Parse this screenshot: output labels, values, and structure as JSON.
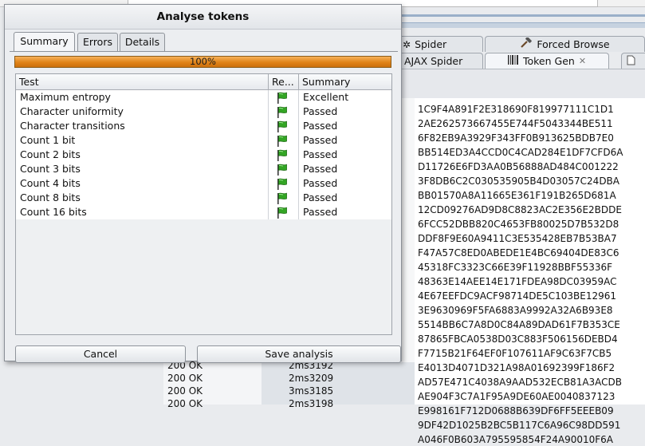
{
  "background": {
    "tabs": {
      "spider": "Spider",
      "forced_browse": "Forced Browse",
      "ajax_spider": "AJAX Spider",
      "token_gen": "Token Gen"
    },
    "tokens": [
      "1C9F4A891F2E318690F819977111C1D1",
      "2AE262573667455E744F5043344BE511",
      "6F82EB9A3929F343FF0B913625BDB7E0",
      "BB514ED3A4CCD0C4CAD284E1DF7CFD6A",
      "D11726E6FD3AA0B56888AD484C001222",
      "3F8DB6C2C030535905B4D03057C24DBA",
      "BB01570A8A11665E361F191B265D681A",
      "12CD09276AD9D8C8823AC2E356E2BDDE",
      "6FCC52DBB820C4653FB80025D7B532D8",
      "DDF8F9E60A9411C3E535428EB7B53BA7",
      "F47A57C8ED0ABEDE1E4BC69404DE83C6",
      "45318FC3323C66E39F11928BBF55336F",
      "48363E14AEE14E171FDEA98DC03959AC",
      "4E67EEFDC9ACF98714DE5C103BE12961",
      "3E9630969F5FA6883A9992A32A6B93E8",
      "5514BB6C7A8D0C84A89DAD61F7B353CE",
      "87865FBCA0538D03C883F506156DEBD4",
      "F7715B21F64EF0F107611AF9C63F7CB5",
      "E4013D4071D321A98A01692399F186F2",
      "AD57E471C4038A9AAD532ECB81A3ACDB",
      "AE904F3C7A1F95A9DE60AE0040837123",
      "E998161F712D0688B639DF6FF5EEEB09",
      "9DF42D1025B2BC5B117C6A96C98DD591",
      "A046F0B603A795595854F24A90010F6A"
    ],
    "bottom_rows": [
      {
        "status": "200 OK",
        "time": "2ms3192"
      },
      {
        "status": "200 OK",
        "time": "2ms3209"
      },
      {
        "status": "200 OK",
        "time": "3ms3185"
      },
      {
        "status": "200 OK",
        "time": "2ms3198"
      }
    ]
  },
  "dialog": {
    "title": "Analyse tokens",
    "tabs": [
      "Summary",
      "Errors",
      "Details"
    ],
    "progress": {
      "value_percent": 100,
      "label": "100%",
      "color": "#e08318"
    },
    "table": {
      "headers": {
        "test": "Test",
        "result": "Re...",
        "summary": "Summary"
      },
      "rows": [
        {
          "test": "Maximum entropy",
          "result_icon": "green-flag-icon",
          "summary": "Excellent"
        },
        {
          "test": "Character uniformity",
          "result_icon": "green-flag-icon",
          "summary": "Passed"
        },
        {
          "test": "Character transitions",
          "result_icon": "green-flag-icon",
          "summary": "Passed"
        },
        {
          "test": "Count 1 bit",
          "result_icon": "green-flag-icon",
          "summary": "Passed"
        },
        {
          "test": "Count 2 bits",
          "result_icon": "green-flag-icon",
          "summary": "Passed"
        },
        {
          "test": "Count 3 bits",
          "result_icon": "green-flag-icon",
          "summary": "Passed"
        },
        {
          "test": "Count 4 bits",
          "result_icon": "green-flag-icon",
          "summary": "Passed"
        },
        {
          "test": "Count 8 bits",
          "result_icon": "green-flag-icon",
          "summary": "Passed"
        },
        {
          "test": "Count 16 bits",
          "result_icon": "green-flag-icon",
          "summary": "Passed"
        }
      ]
    },
    "buttons": {
      "cancel": "Cancel",
      "save": "Save analysis"
    }
  }
}
